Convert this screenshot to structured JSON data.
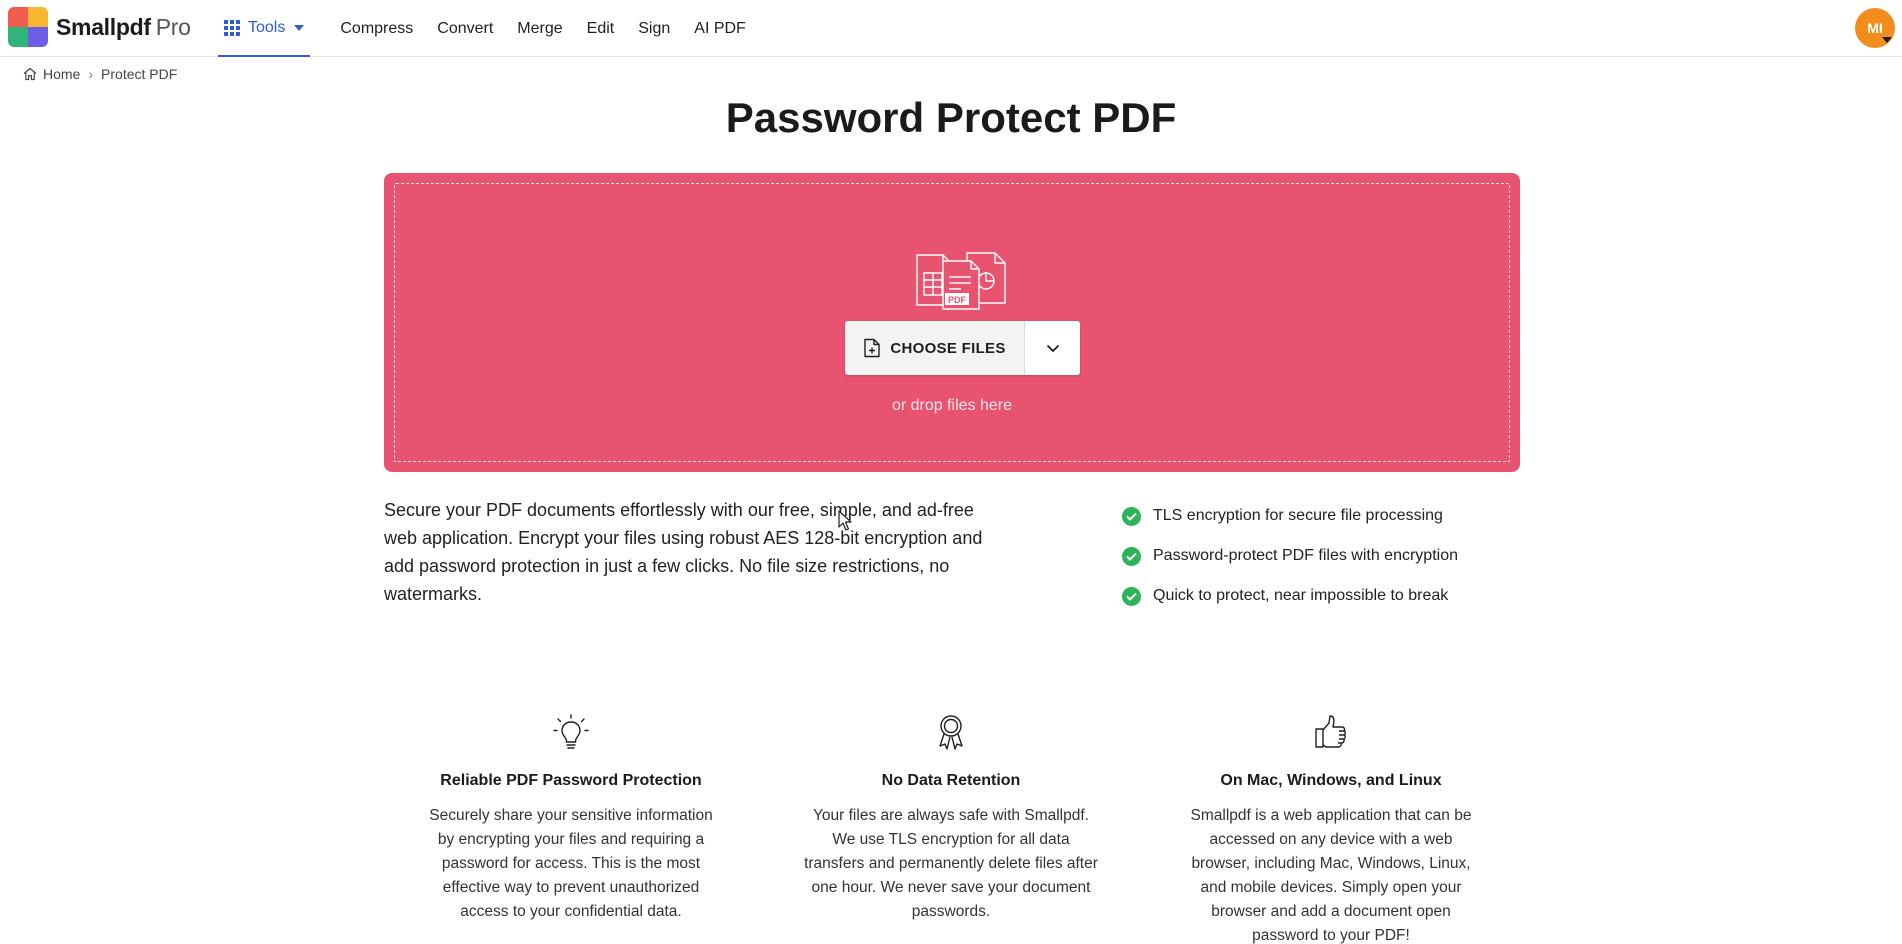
{
  "brand": {
    "name": "Smallpdf",
    "suffix": "Pro"
  },
  "nav": {
    "tools_label": "Tools",
    "items": [
      "Compress",
      "Convert",
      "Merge",
      "Edit",
      "Sign",
      "AI PDF"
    ]
  },
  "user": {
    "initials": "MI"
  },
  "breadcrumb": {
    "home": "Home",
    "current": "Protect PDF"
  },
  "page": {
    "title": "Password Protect PDF"
  },
  "dropzone": {
    "choose_label": "CHOOSE FILES",
    "hint": "or drop files here",
    "illustration_label": "PDF"
  },
  "description": "Secure your PDF documents effortlessly with our free, simple, and ad-free web application. Encrypt your files using robust AES 128-bit encryption and add password protection in just a few clicks. No file size restrictions, no watermarks.",
  "features": [
    "TLS encryption for secure file processing",
    "Password-protect PDF files with encryption",
    "Quick to protect, near impossible to break"
  ],
  "cards": [
    {
      "icon": "lightbulb-icon",
      "title": "Reliable PDF Password Protection",
      "text": "Securely share your sensitive information by encrypting your files and requiring a password for access. This is the most effective way to prevent unauthorized access to your confidential data."
    },
    {
      "icon": "award-ribbon-icon",
      "title": "No Data Retention",
      "text": "Your files are always safe with Smallpdf. We use TLS encryption for all data transfers and permanently delete files after one hour. We never save your document passwords."
    },
    {
      "icon": "thumbs-up-icon",
      "title": "On Mac, Windows, and Linux",
      "text": "Smallpdf is a web application that can be accessed on any device with a web browser, including Mac, Windows, Linux, and mobile devices. Simply open your browser and add a document open password to your PDF!"
    }
  ],
  "colors": {
    "accent": "#2f5ad8",
    "dropzone": "#e8546f",
    "check": "#2eb25a",
    "avatar": "#f28c1c"
  }
}
